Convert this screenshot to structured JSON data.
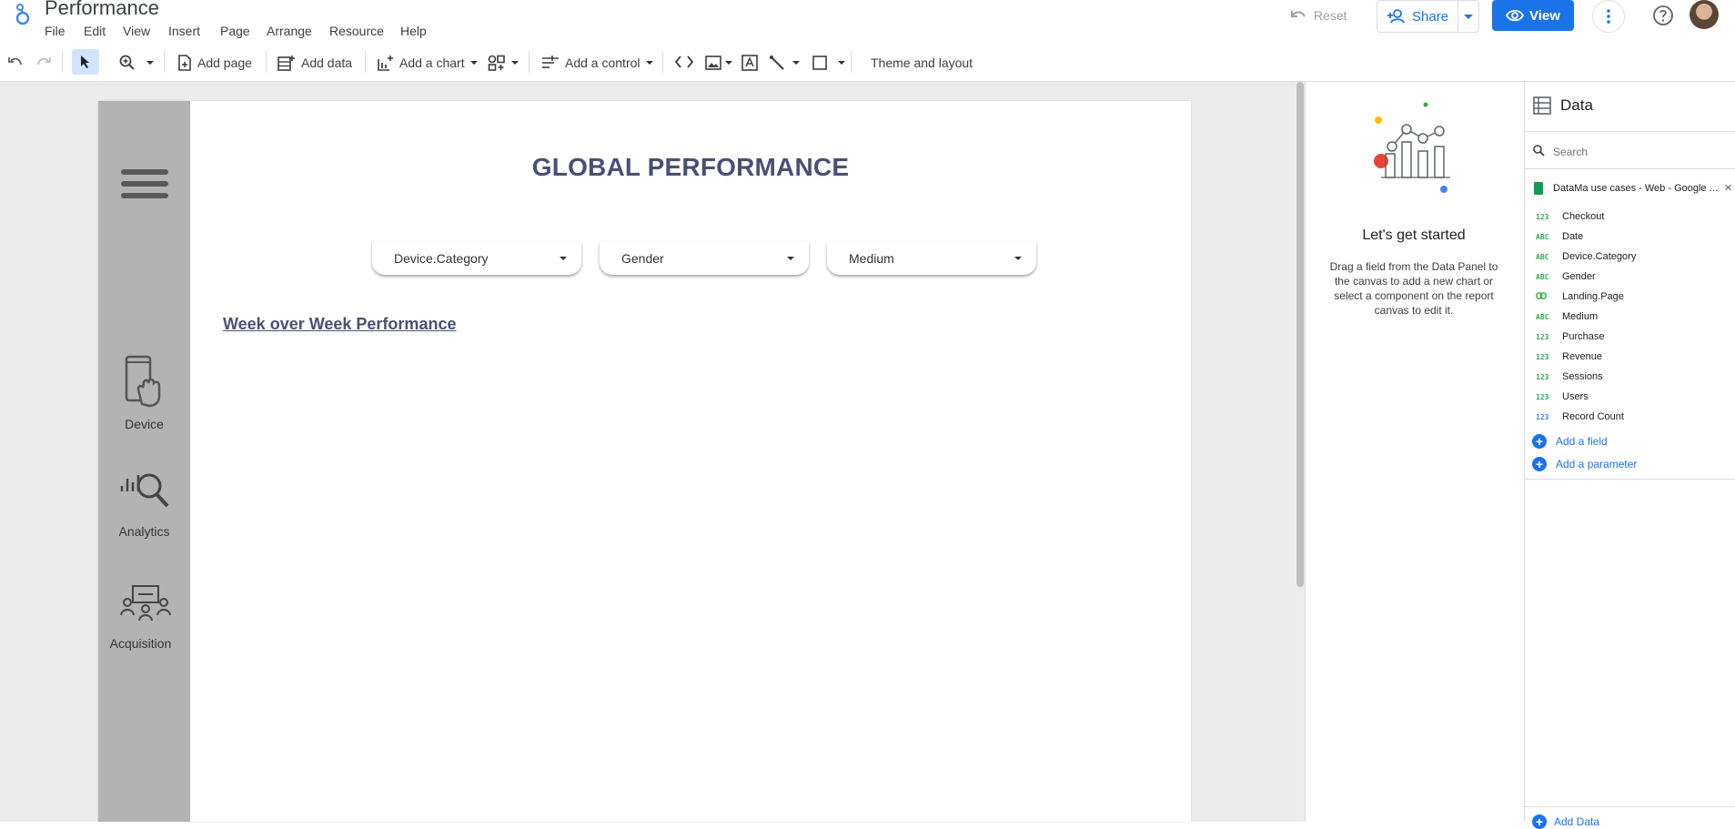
{
  "app": {
    "title": "Performance"
  },
  "menu": [
    "File",
    "Edit",
    "View",
    "Insert",
    "Page",
    "Arrange",
    "Resource",
    "Help"
  ],
  "header_actions": {
    "reset": "Reset",
    "share": "Share",
    "view": "View"
  },
  "toolbar": {
    "add_page": "Add page",
    "add_data": "Add data",
    "add_chart": "Add a chart",
    "add_control": "Add a control",
    "theme_layout": "Theme and layout"
  },
  "report": {
    "title": "GLOBAL PERFORMANCE",
    "filters": [
      "Device.Category",
      "Gender",
      "Medium"
    ],
    "section_title": "Week over Week Performance",
    "nav": [
      {
        "label": "Device",
        "icon": "phone-touch-icon"
      },
      {
        "label": "Analytics",
        "icon": "analytics-search-icon"
      },
      {
        "label": "Acquisition",
        "icon": "team-network-icon"
      }
    ]
  },
  "properties_panel": {
    "heading": "Let's get started",
    "description": "Drag a field from the Data Panel to the canvas to add a new chart or select a component on the report canvas to edit it."
  },
  "data_panel": {
    "title": "Data",
    "search_placeholder": "Search",
    "source_name": "DataMa use cases - Web - Google A...",
    "fields": [
      {
        "type": "123",
        "name": "Checkout"
      },
      {
        "type": "ABC",
        "name": "Date"
      },
      {
        "type": "ABC",
        "name": "Device.Category"
      },
      {
        "type": "ABC",
        "name": "Gender"
      },
      {
        "type": "link",
        "name": "Landing.Page"
      },
      {
        "type": "ABC",
        "name": "Medium"
      },
      {
        "type": "123",
        "name": "Purchase"
      },
      {
        "type": "123",
        "name": "Revenue"
      },
      {
        "type": "123",
        "name": "Sessions"
      },
      {
        "type": "123",
        "name": "Users"
      },
      {
        "type": "123",
        "name": "Record Count"
      }
    ],
    "add_field": "Add a field",
    "add_parameter": "Add a parameter",
    "add_data": "Add Data"
  },
  "colors": {
    "accent": "#1a73e8",
    "nav_bg": "#b3b3b3",
    "title_color": "#4a5073",
    "sheets_green": "#0f9d58"
  }
}
